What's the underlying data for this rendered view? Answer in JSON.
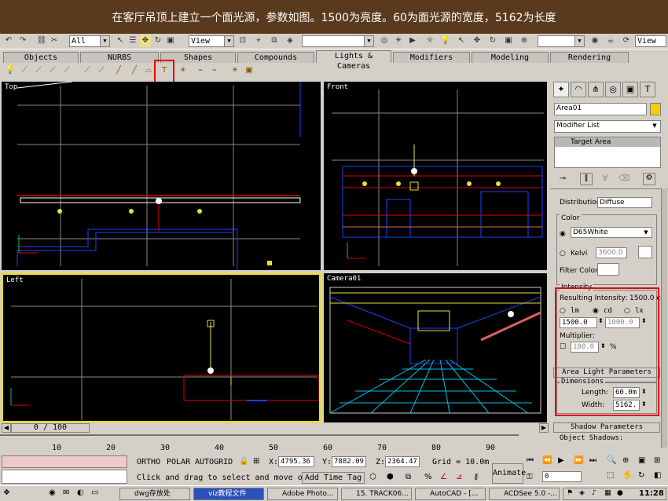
{
  "banner": {
    "text": "在客厅吊顶上建立一个面光源，参数如图。1500为亮度。60为面光源的宽度，5162为长度"
  },
  "toolbar": {
    "filter_value": "All",
    "view_value": "View",
    "view_value2": "View"
  },
  "tabs": [
    "Objects",
    "NURBS",
    "Shapes",
    "Compounds",
    "Lights & Cameras",
    "Modifiers",
    "Modeling",
    "Rendering"
  ],
  "active_tab": "Lights & Cameras",
  "viewports": {
    "top": "Top",
    "front": "Front",
    "left": "Left",
    "camera": "Camera01"
  },
  "panel": {
    "object_name": "Area01",
    "modifier_list": "Modifier List",
    "stack_item": "Target Area",
    "distribution_label": "Distribution:",
    "distribution_value": "Diffuse",
    "color_group": "Color",
    "color_preset": "D65White",
    "kelvin_label": "Kelvi",
    "kelvin_value": "3600.0",
    "filter_color": "Filter Color:",
    "intensity_group": "Intensity",
    "resulting_intensity": "Resulting Intensity: 1500.0 cd",
    "unit_lm": "lm",
    "unit_cd": "cd",
    "unit_lx": "lx",
    "intensity_value": "1500.0",
    "intensity_value2": "1000.0",
    "multiplier_label": "Multiplier:",
    "multiplier_value": "100.0",
    "percent": "%",
    "area_rollout": "Area Light Parameters",
    "dimensions_group": "Dimensions",
    "length_label": "Length:",
    "length_value": "60.0m",
    "width_label": "Width:",
    "width_value": "5162.",
    "shadow_rollout": "Shadow Parameters",
    "object_shadows": "Object Shadows:"
  },
  "timeline": {
    "frame": "0 / 100",
    "ticks": [
      "10",
      "20",
      "30",
      "40",
      "50",
      "60",
      "70",
      "80",
      "90"
    ]
  },
  "status": {
    "ortho": "ORTHO",
    "polar": "POLAR",
    "autogrid": "AUTOGRID",
    "x_label": "X:",
    "x_value": "4795.36",
    "y_label": "Y:",
    "y_value": "7882.09",
    "z_label": "Z:",
    "z_value": "2364.47",
    "grid": "Grid = 10.0m",
    "prompt": "Click and drag to select and move o",
    "add_time_tag": "Add Time Tag",
    "animate": "Animate",
    "frame_field": "0"
  },
  "taskbar": {
    "items": [
      "dwg存放处",
      "viz教程文件",
      "Adobe Photo...",
      "15. TRACK06...",
      "AutoCAD - [...",
      "ACDSee 5.0 -..."
    ],
    "active_index": 1,
    "clock": "11:28"
  },
  "colors": {
    "banner_bg": "#5a3a1c",
    "highlight": "#e00000",
    "active_viewport": "#f0e000"
  }
}
